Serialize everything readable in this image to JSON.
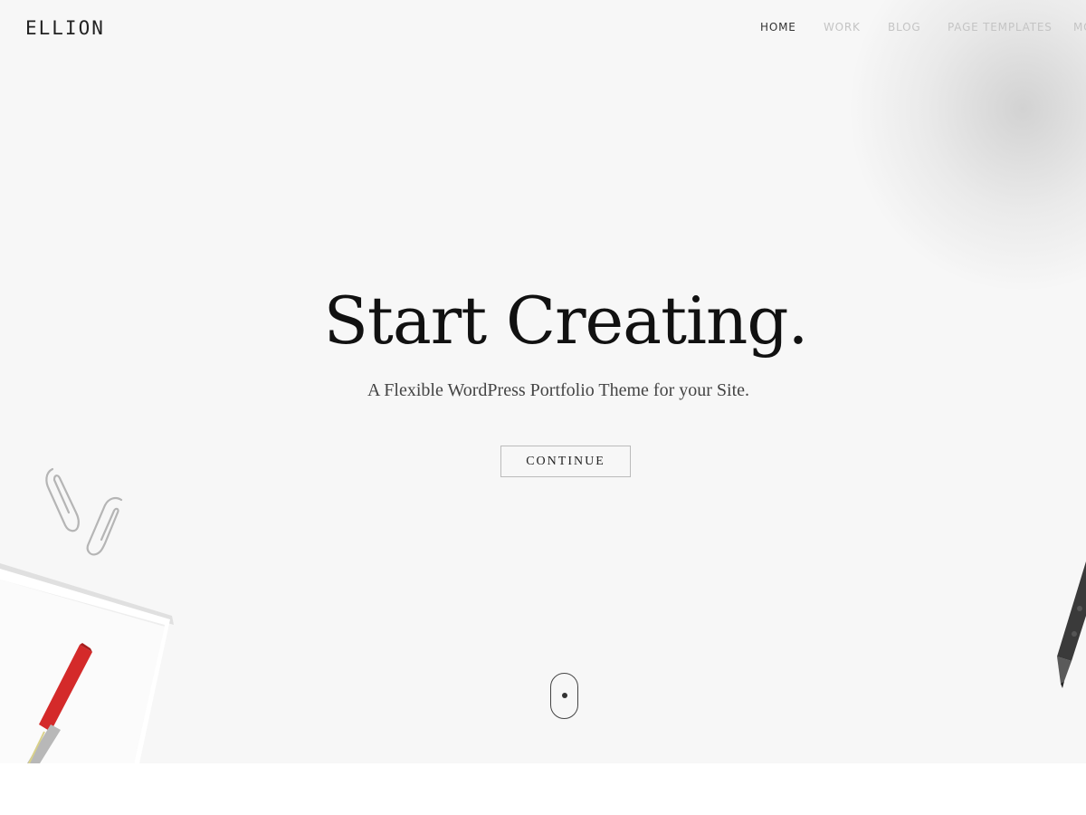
{
  "header": {
    "logo": "ELLION",
    "nav": [
      {
        "label": "HOME",
        "active": true
      },
      {
        "label": "WORK",
        "active": false
      },
      {
        "label": "BLOG",
        "active": false
      },
      {
        "label": "PAGE TEMPLATES",
        "active": false
      },
      {
        "label": "MO",
        "active": false
      }
    ]
  },
  "hero": {
    "headline": "Start Creating.",
    "subheadline": "A Flexible WordPress Portfolio Theme for your Site.",
    "cta_label": "CONTINUE"
  },
  "colors": {
    "hero_background": "#f7f7f7",
    "text_dark": "#111111",
    "nav_inactive": "#c4c4c4",
    "pen_red": "#d42a2a"
  },
  "icons": {
    "scroll_indicator": "mouse-scroll-icon",
    "decor_paperclips": "paperclip-icon",
    "decor_pen": "pen-icon",
    "decor_marker": "marker-icon"
  }
}
